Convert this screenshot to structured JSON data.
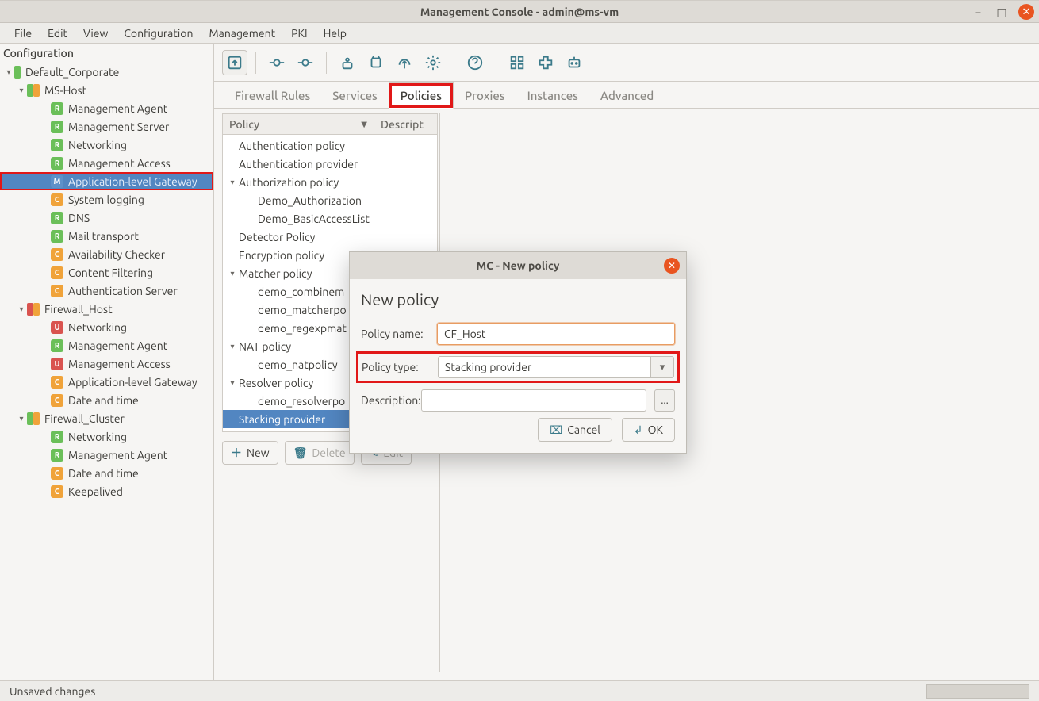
{
  "window": {
    "title": "Management Console - admin@ms-vm"
  },
  "menu": {
    "items": [
      "File",
      "Edit",
      "View",
      "Configuration",
      "Management",
      "PKI",
      "Help"
    ]
  },
  "sidebar": {
    "header": "Configuration",
    "nodes": [
      {
        "type": "site",
        "label": "Default_Corporate",
        "colors": [
          "green"
        ]
      },
      {
        "type": "host",
        "label": "MS-Host",
        "colors": [
          "green",
          "orange"
        ]
      },
      {
        "type": "item",
        "badge": "R",
        "color": "green",
        "label": "Management Agent"
      },
      {
        "type": "item",
        "badge": "R",
        "color": "green",
        "label": "Management Server"
      },
      {
        "type": "item",
        "badge": "R",
        "color": "green",
        "label": "Networking"
      },
      {
        "type": "item",
        "badge": "R",
        "color": "green",
        "label": "Management Access"
      },
      {
        "type": "item",
        "badge": "M",
        "color": "blue",
        "label": "Application-level Gateway",
        "selected": true,
        "highlight": true
      },
      {
        "type": "item",
        "badge": "C",
        "color": "orange",
        "label": "System logging"
      },
      {
        "type": "item",
        "badge": "R",
        "color": "green",
        "label": "DNS"
      },
      {
        "type": "item",
        "badge": "R",
        "color": "green",
        "label": "Mail transport"
      },
      {
        "type": "item",
        "badge": "C",
        "color": "orange",
        "label": "Availability Checker"
      },
      {
        "type": "item",
        "badge": "C",
        "color": "orange",
        "label": "Content Filtering"
      },
      {
        "type": "item",
        "badge": "C",
        "color": "orange",
        "label": "Authentication Server"
      },
      {
        "type": "host",
        "label": "Firewall_Host",
        "colors": [
          "red",
          "orange"
        ]
      },
      {
        "type": "item",
        "badge": "U",
        "color": "red",
        "label": "Networking"
      },
      {
        "type": "item",
        "badge": "R",
        "color": "green",
        "label": "Management Agent"
      },
      {
        "type": "item",
        "badge": "U",
        "color": "red",
        "label": "Management Access"
      },
      {
        "type": "item",
        "badge": "C",
        "color": "orange",
        "label": "Application-level Gateway"
      },
      {
        "type": "item",
        "badge": "C",
        "color": "orange",
        "label": "Date and time"
      },
      {
        "type": "host",
        "label": "Firewall_Cluster",
        "colors": [
          "green",
          "orange"
        ]
      },
      {
        "type": "item",
        "badge": "R",
        "color": "green",
        "label": "Networking"
      },
      {
        "type": "item",
        "badge": "R",
        "color": "green",
        "label": "Management Agent"
      },
      {
        "type": "item",
        "badge": "C",
        "color": "orange",
        "label": "Date and time"
      },
      {
        "type": "item",
        "badge": "C",
        "color": "orange",
        "label": "Keepalived"
      }
    ]
  },
  "subtabs": [
    "Firewall Rules",
    "Services",
    "Policies",
    "Proxies",
    "Instances",
    "Advanced"
  ],
  "policyList": {
    "headerPolicy": "Policy",
    "headerDesc": "Descript",
    "groups": [
      {
        "label": "Authentication policy",
        "expand": ""
      },
      {
        "label": "Authentication provider",
        "expand": ""
      },
      {
        "label": "Authorization policy",
        "expand": "open",
        "children": [
          "Demo_Authorization",
          "Demo_BasicAccessList"
        ]
      },
      {
        "label": "Detector Policy",
        "expand": ""
      },
      {
        "label": "Encryption policy",
        "expand": ""
      },
      {
        "label": "Matcher policy",
        "expand": "open",
        "children": [
          "demo_combinem",
          "demo_matcherpo",
          "demo_regexpmat"
        ]
      },
      {
        "label": "NAT policy",
        "expand": "open",
        "children": [
          "demo_natpolicy"
        ]
      },
      {
        "label": "Resolver policy",
        "expand": "open",
        "children": [
          "demo_resolverpo"
        ]
      },
      {
        "label": "Stacking provider",
        "expand": "",
        "selected": true
      }
    ]
  },
  "panelButtons": {
    "new": "New",
    "delete": "Delete",
    "edit": "Edit"
  },
  "dialog": {
    "title": "MC - New policy",
    "heading": "New policy",
    "labels": {
      "name": "Policy name:",
      "type": "Policy type:",
      "desc": "Description:"
    },
    "values": {
      "name": "CF_Host",
      "type": "Stacking provider",
      "desc": ""
    },
    "buttons": {
      "cancel": "Cancel",
      "ok": "OK"
    },
    "more": "..."
  },
  "status": {
    "text": "Unsaved changes"
  },
  "winControls": {
    "min": "–",
    "max": "□",
    "close": "✕"
  }
}
